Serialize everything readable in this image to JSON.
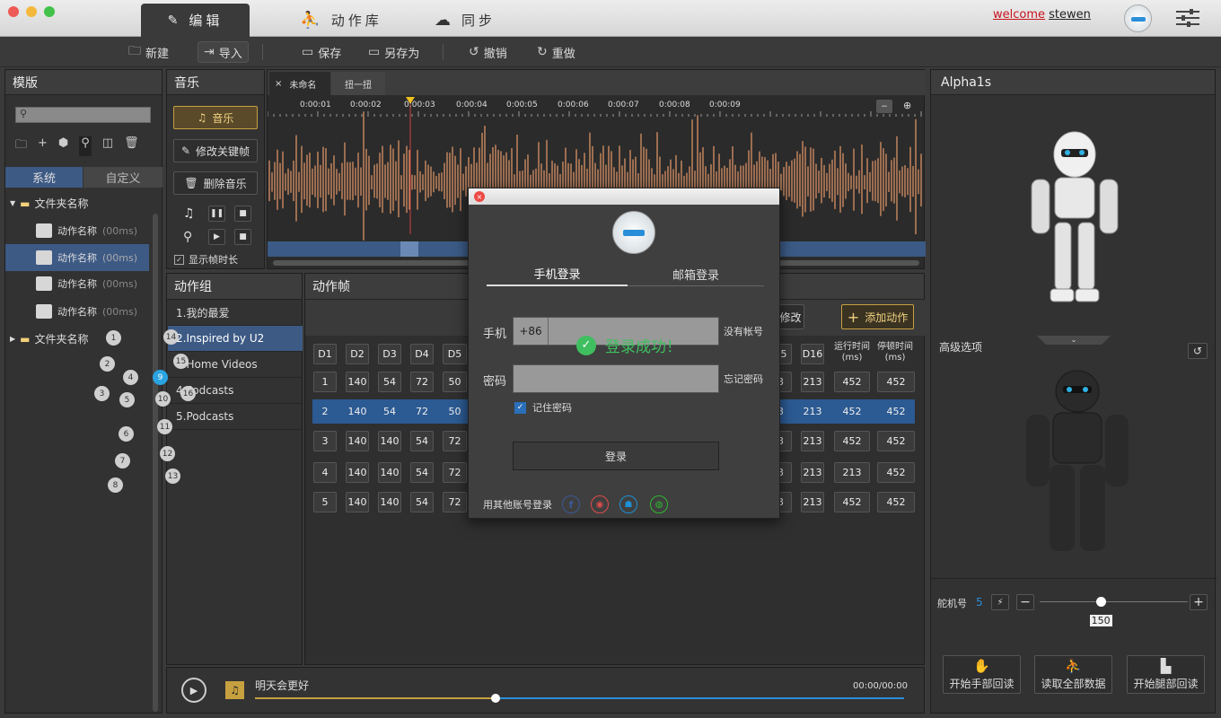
{
  "app": {
    "tabs": [
      {
        "label": "编辑"
      },
      {
        "label": "动作库"
      },
      {
        "label": "同步"
      }
    ],
    "welcome": "welcome",
    "user": "stewen"
  },
  "toolbar": {
    "new": "新建",
    "import": "导入",
    "save": "保存",
    "saveas": "另存为",
    "undo": "撤销",
    "redo": "重做"
  },
  "template": {
    "title": "模版",
    "tab_system": "系统",
    "tab_custom": "自定义",
    "folder1": "文件夹名称",
    "folder2": "文件夹名称",
    "items": [
      {
        "name": "动作名称",
        "time": "(00ms)"
      },
      {
        "name": "动作名称",
        "time": "(00ms)"
      },
      {
        "name": "动作名称",
        "time": "(00ms)"
      },
      {
        "name": "动作名称",
        "time": "(00ms)"
      }
    ]
  },
  "music": {
    "title": "音乐",
    "music_btn": "音乐",
    "edit_key_btn": "修改关键帧",
    "delete_btn": "删除音乐",
    "show_frame": "显示帧时长"
  },
  "timeline": {
    "tabs": [
      "未命名",
      "扭一扭"
    ],
    "ticks": [
      "0:00:01",
      "0:00:02",
      "0:00:03",
      "0:00:04",
      "0:00:05",
      "0:00:06",
      "0:00:07",
      "0:00:08",
      "0:00:09"
    ]
  },
  "groups": {
    "title": "动作组",
    "items": [
      "1.我的最爱",
      "2.Inspired by U2",
      "3.Home Videos",
      "4.Podcasts",
      "5.Podcasts"
    ]
  },
  "frames": {
    "title": "动作帧",
    "modify": "修改",
    "add": "添加动作",
    "headers_left": [
      "D1",
      "D2",
      "D3",
      "D4",
      "D5"
    ],
    "headers_right": [
      "15",
      "D16"
    ],
    "run_time": "运行时间",
    "stop_time": "停顿时间",
    "unit": "(ms)",
    "rows": [
      {
        "id": "1",
        "l": [
          "140",
          "54",
          "72",
          "50"
        ],
        "r": [
          "3",
          "213"
        ],
        "run": "452",
        "stop": "452"
      },
      {
        "id": "2",
        "l": [
          "140",
          "54",
          "72",
          "50"
        ],
        "r": [
          "3",
          "213"
        ],
        "run": "452",
        "stop": "452"
      },
      {
        "id": "3",
        "l": [
          "140",
          "140",
          "54",
          "72"
        ],
        "r": [
          "3",
          "213"
        ],
        "run": "452",
        "stop": "452"
      },
      {
        "id": "4",
        "l": [
          "140",
          "140",
          "54",
          "72"
        ],
        "r": [
          "3",
          "213"
        ],
        "run": "213",
        "stop": "452"
      },
      {
        "id": "5",
        "l": [
          "140",
          "140",
          "54",
          "72"
        ],
        "r": [
          "3",
          "213"
        ],
        "run": "452",
        "stop": "452"
      }
    ]
  },
  "player": {
    "song": "明天会更好",
    "time": "00:00/00:00",
    "progress": 0.37
  },
  "robot": {
    "title": "Alpha1s",
    "advanced": "高级选项",
    "joints": [
      "1",
      "2",
      "3",
      "4",
      "5",
      "6",
      "7",
      "8",
      "9",
      "10",
      "11",
      "12",
      "13",
      "14",
      "15",
      "16"
    ],
    "selected_joint": "9",
    "servo_label": "舵机号",
    "servo_no": "5",
    "servo_value": "150",
    "slider_fraction": 0.41,
    "btn_hand": "开始手部回读",
    "btn_all": "读取全部数据",
    "btn_leg": "开始腿部回读"
  },
  "login": {
    "tab_phone": "手机登录",
    "tab_email": "邮箱登录",
    "phone_label": "手机",
    "code": "+86",
    "no_account": "没有帐号",
    "success": "登录成功！",
    "pwd_label": "密码",
    "forgot": "忘记密码",
    "remember": "记住密码",
    "login_btn": "登录",
    "other": "用其他账号登录",
    "social": [
      "facebook-icon",
      "twitter-icon",
      "qq-icon",
      "wechat-icon"
    ]
  },
  "colors": {
    "accent": "#2a8fd8",
    "wave": "#e89a6a",
    "success": "#3fbf5f",
    "gold": "#c7a040"
  }
}
